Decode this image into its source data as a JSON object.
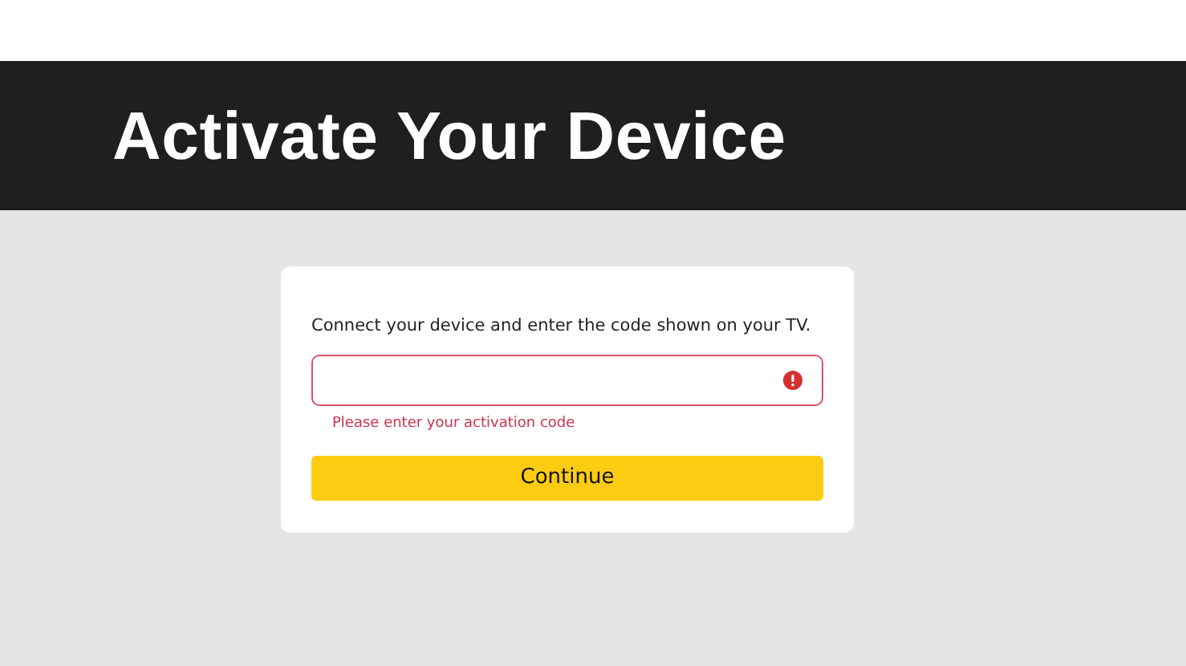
{
  "header": {
    "title": "Activate Your Device"
  },
  "form": {
    "instruction": "Connect your device and enter the code shown on your TV.",
    "code_field": {
      "invalid": true,
      "error": "Please enter your activation code"
    },
    "submit_button": "Continue"
  }
}
